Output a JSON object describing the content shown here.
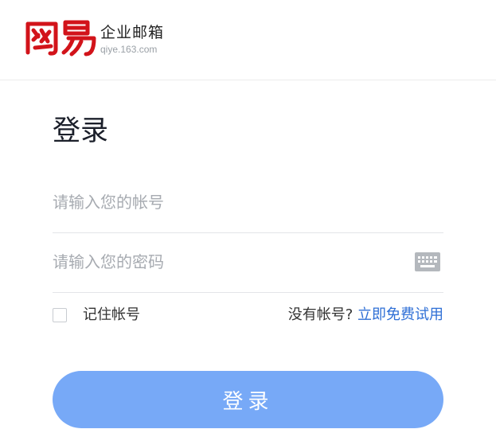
{
  "header": {
    "brand_logo": "網易",
    "product_name": "企业邮箱",
    "domain": "qiye.163.com"
  },
  "login": {
    "title": "登录",
    "account_placeholder": "请输入您的帐号",
    "password_placeholder": "请输入您的密码",
    "keyboard_icon": "keyboard-icon",
    "remember_label": "记住帐号",
    "no_account_text": "没有帐号?",
    "free_trial_link": "立即免费试用",
    "submit_label": "登录"
  },
  "colors": {
    "brand_red": "#d2131a",
    "link_blue": "#2f6fd6",
    "button_blue": "#77a9f7"
  }
}
